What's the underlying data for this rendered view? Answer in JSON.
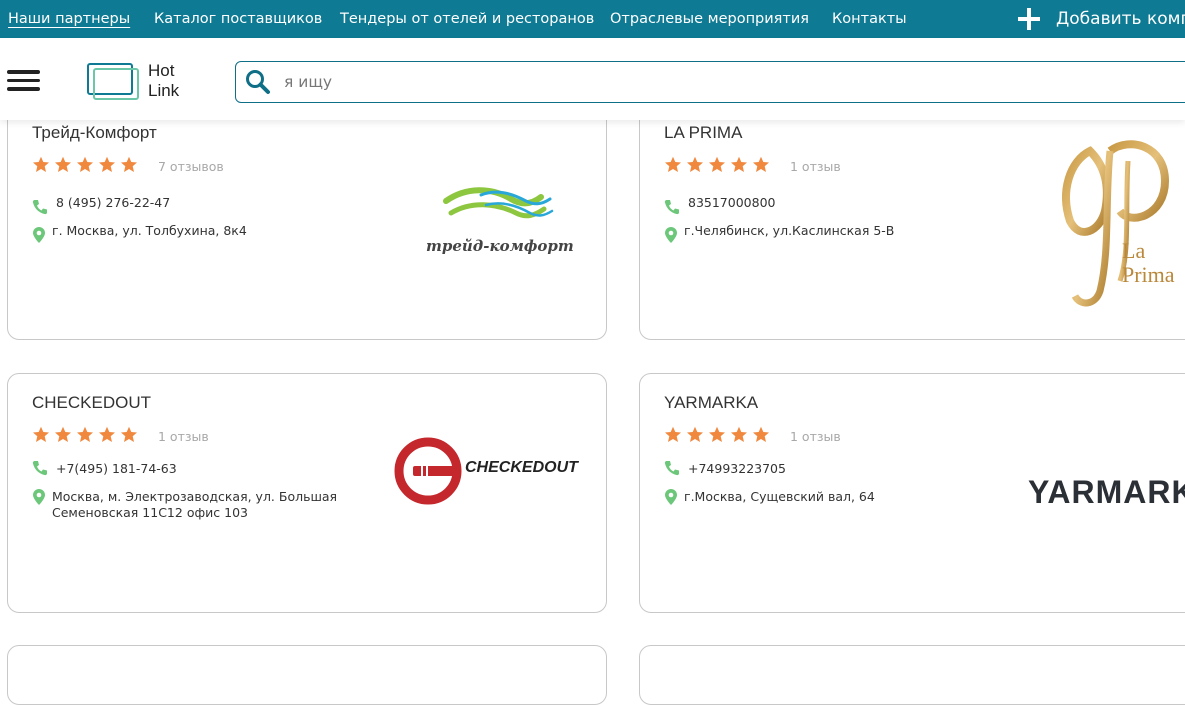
{
  "topnav": {
    "items": [
      {
        "label": "Наши партнеры",
        "active": true
      },
      {
        "label": "Каталог поставщиков"
      },
      {
        "label": "Тендеры от отелей и ресторанов"
      },
      {
        "label": "Отраслевые мероприятия"
      },
      {
        "label": "Контакты"
      }
    ],
    "add_label": "Добавить компанию",
    "bg_color": "#0e7a93"
  },
  "header": {
    "menu_icon": "hamburger-icon",
    "logo": {
      "line1": "Hot",
      "line2": "Link"
    },
    "search": {
      "placeholder": "я ищу",
      "value": "",
      "icon": "search-icon"
    }
  },
  "accent_star_color": "#f0883e",
  "cards": [
    {
      "name": "Трейд-Комфорт",
      "rating": 5,
      "reviews": "7 отзывов",
      "phone": "8 (495) 276-22-47",
      "address": "г. Москва, ул. Толбухина, 8к4",
      "logo_text": "трейд-комфорт"
    },
    {
      "name": "LA PRIMA",
      "rating": 5,
      "reviews": "1 отзыв",
      "phone": "83517000800",
      "address": "г.Челябинск, ул.Каслинская 5-В",
      "logo_text": "La Prima"
    },
    {
      "name": "CHECKEDOUT",
      "rating": 5,
      "reviews": "1 отзыв",
      "phone": "+7(495) 181-74-63",
      "address": "Москва, м. Электрозаводская, ул. Большая Семеновская 11С12 офис 103",
      "logo_text": "CHECKEDOUT"
    },
    {
      "name": "YARMARKA",
      "rating": 5,
      "reviews": "1 отзыв",
      "phone": "+74993223705",
      "address": "г.Москва, Сущевский вал, 64",
      "logo_text": "YARMARKA"
    }
  ]
}
